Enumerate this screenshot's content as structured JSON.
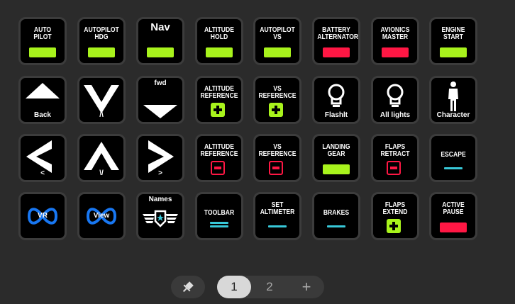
{
  "keys": [
    {
      "label": "AUTO\nPILOT",
      "pos": "top",
      "widget": "bar",
      "color": "#a8f31c"
    },
    {
      "label": "AUTOPILOT\nHDG",
      "pos": "top",
      "widget": "bar",
      "color": "#a8f31c"
    },
    {
      "label": "Nav",
      "pos": "nav",
      "widget": "bar",
      "color": "#a8f31c"
    },
    {
      "label": "ALTITUDE\nHOLD",
      "pos": "top",
      "widget": "bar",
      "color": "#a8f31c"
    },
    {
      "label": "AUTOPILOT\nVS",
      "pos": "top",
      "widget": "bar",
      "color": "#a8f31c"
    },
    {
      "label": "BATTERY\nALTERNATOR",
      "pos": "top",
      "widget": "bar",
      "color": "#ff1744"
    },
    {
      "label": "AVIONICS\nMASTER",
      "pos": "top",
      "widget": "bar",
      "color": "#ff1744"
    },
    {
      "label": "ENGINE\nSTART",
      "pos": "top",
      "widget": "bar",
      "color": "#a8f31c"
    },
    {
      "label": "Back",
      "pos": "bottom",
      "widget": "tri-up"
    },
    {
      "label": "/\\",
      "pos": "bottom",
      "widget": "chev-down"
    },
    {
      "label": "fwd",
      "pos": "small",
      "widget": "tri-down"
    },
    {
      "label": "ALTITUDE\nREFERENCE",
      "pos": "top",
      "widget": "plus",
      "color": "#a8f31c"
    },
    {
      "label": "VS\nREFERENCE",
      "pos": "top",
      "widget": "plus",
      "color": "#a8f31c"
    },
    {
      "label": "Flashlt",
      "pos": "bottom",
      "widget": "bulb"
    },
    {
      "label": "All lights",
      "pos": "bottom",
      "widget": "bulb"
    },
    {
      "label": "Character",
      "pos": "bottom",
      "widget": "person"
    },
    {
      "label": "<",
      "pos": "bottom",
      "widget": "chev-left"
    },
    {
      "label": "\\/",
      "pos": "bottom",
      "widget": "chev-up"
    },
    {
      "label": ">",
      "pos": "bottom",
      "widget": "chev-right"
    },
    {
      "label": "ALTITUDE\nREFERENCE",
      "pos": "top",
      "widget": "minus",
      "color": "#ff1744"
    },
    {
      "label": "VS\nREFERENCE",
      "pos": "top",
      "widget": "minus",
      "color": "#ff1744"
    },
    {
      "label": "LANDING\nGEAR",
      "pos": "top",
      "widget": "bar",
      "color": "#a8f31c"
    },
    {
      "label": "FLAPS\nRETRACT",
      "pos": "top",
      "widget": "minus",
      "color": "#ff1744"
    },
    {
      "label": "ESCAPE",
      "pos": "mid",
      "widget": "thin",
      "color": "#38c8d8"
    },
    {
      "label": "VR",
      "pos": "none",
      "widget": "meta"
    },
    {
      "label": "View",
      "pos": "none",
      "widget": "meta"
    },
    {
      "label": "Names",
      "pos": "small",
      "widget": "wings"
    },
    {
      "label": "TOOLBAR",
      "pos": "mid",
      "widget": "double",
      "color": "#38c8d8"
    },
    {
      "label": "SET\nALTIMETER",
      "pos": "top",
      "widget": "thin",
      "color": "#38c8d8"
    },
    {
      "label": "BRAKES",
      "pos": "mid",
      "widget": "thin",
      "color": "#38c8d8"
    },
    {
      "label": "FLAPS\nEXTEND",
      "pos": "top",
      "widget": "plus",
      "color": "#a8f31c"
    },
    {
      "label": "ACTIVE\nPAUSE",
      "pos": "top",
      "widget": "bar",
      "color": "#ff1744"
    }
  ],
  "pager": {
    "pages": [
      "1",
      "2"
    ],
    "active_page": "1",
    "add_label": "+",
    "pin_icon": "pin-icon"
  }
}
